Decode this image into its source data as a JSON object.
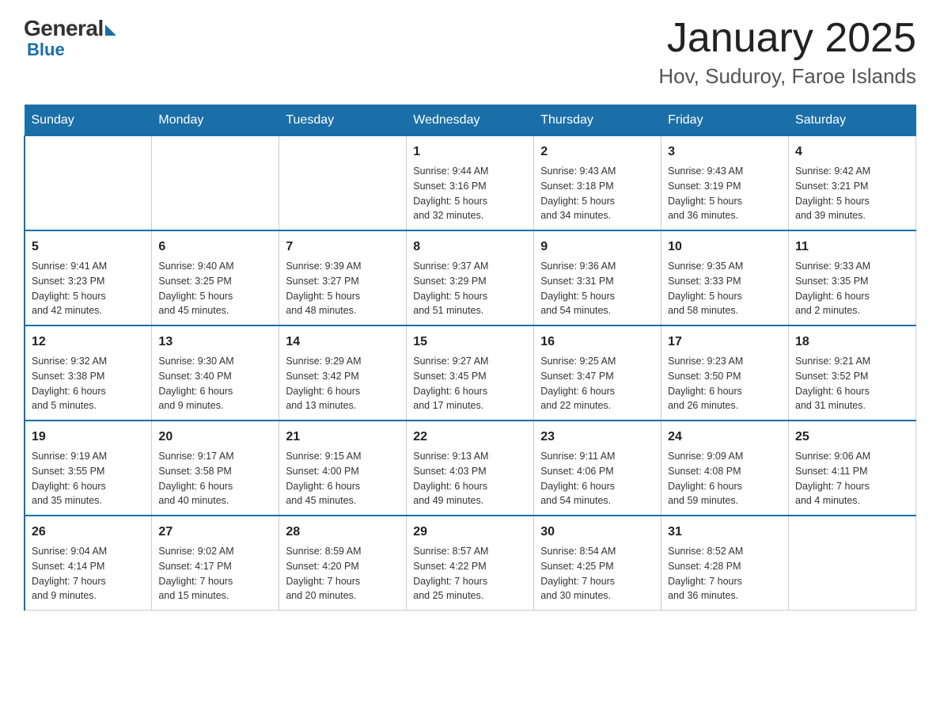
{
  "logo": {
    "general_text": "General",
    "blue_text": "Blue"
  },
  "title": "January 2025",
  "subtitle": "Hov, Suduroy, Faroe Islands",
  "weekdays": [
    "Sunday",
    "Monday",
    "Tuesday",
    "Wednesday",
    "Thursday",
    "Friday",
    "Saturday"
  ],
  "weeks": [
    [
      {
        "day": "",
        "info": ""
      },
      {
        "day": "",
        "info": ""
      },
      {
        "day": "",
        "info": ""
      },
      {
        "day": "1",
        "info": "Sunrise: 9:44 AM\nSunset: 3:16 PM\nDaylight: 5 hours\nand 32 minutes."
      },
      {
        "day": "2",
        "info": "Sunrise: 9:43 AM\nSunset: 3:18 PM\nDaylight: 5 hours\nand 34 minutes."
      },
      {
        "day": "3",
        "info": "Sunrise: 9:43 AM\nSunset: 3:19 PM\nDaylight: 5 hours\nand 36 minutes."
      },
      {
        "day": "4",
        "info": "Sunrise: 9:42 AM\nSunset: 3:21 PM\nDaylight: 5 hours\nand 39 minutes."
      }
    ],
    [
      {
        "day": "5",
        "info": "Sunrise: 9:41 AM\nSunset: 3:23 PM\nDaylight: 5 hours\nand 42 minutes."
      },
      {
        "day": "6",
        "info": "Sunrise: 9:40 AM\nSunset: 3:25 PM\nDaylight: 5 hours\nand 45 minutes."
      },
      {
        "day": "7",
        "info": "Sunrise: 9:39 AM\nSunset: 3:27 PM\nDaylight: 5 hours\nand 48 minutes."
      },
      {
        "day": "8",
        "info": "Sunrise: 9:37 AM\nSunset: 3:29 PM\nDaylight: 5 hours\nand 51 minutes."
      },
      {
        "day": "9",
        "info": "Sunrise: 9:36 AM\nSunset: 3:31 PM\nDaylight: 5 hours\nand 54 minutes."
      },
      {
        "day": "10",
        "info": "Sunrise: 9:35 AM\nSunset: 3:33 PM\nDaylight: 5 hours\nand 58 minutes."
      },
      {
        "day": "11",
        "info": "Sunrise: 9:33 AM\nSunset: 3:35 PM\nDaylight: 6 hours\nand 2 minutes."
      }
    ],
    [
      {
        "day": "12",
        "info": "Sunrise: 9:32 AM\nSunset: 3:38 PM\nDaylight: 6 hours\nand 5 minutes."
      },
      {
        "day": "13",
        "info": "Sunrise: 9:30 AM\nSunset: 3:40 PM\nDaylight: 6 hours\nand 9 minutes."
      },
      {
        "day": "14",
        "info": "Sunrise: 9:29 AM\nSunset: 3:42 PM\nDaylight: 6 hours\nand 13 minutes."
      },
      {
        "day": "15",
        "info": "Sunrise: 9:27 AM\nSunset: 3:45 PM\nDaylight: 6 hours\nand 17 minutes."
      },
      {
        "day": "16",
        "info": "Sunrise: 9:25 AM\nSunset: 3:47 PM\nDaylight: 6 hours\nand 22 minutes."
      },
      {
        "day": "17",
        "info": "Sunrise: 9:23 AM\nSunset: 3:50 PM\nDaylight: 6 hours\nand 26 minutes."
      },
      {
        "day": "18",
        "info": "Sunrise: 9:21 AM\nSunset: 3:52 PM\nDaylight: 6 hours\nand 31 minutes."
      }
    ],
    [
      {
        "day": "19",
        "info": "Sunrise: 9:19 AM\nSunset: 3:55 PM\nDaylight: 6 hours\nand 35 minutes."
      },
      {
        "day": "20",
        "info": "Sunrise: 9:17 AM\nSunset: 3:58 PM\nDaylight: 6 hours\nand 40 minutes."
      },
      {
        "day": "21",
        "info": "Sunrise: 9:15 AM\nSunset: 4:00 PM\nDaylight: 6 hours\nand 45 minutes."
      },
      {
        "day": "22",
        "info": "Sunrise: 9:13 AM\nSunset: 4:03 PM\nDaylight: 6 hours\nand 49 minutes."
      },
      {
        "day": "23",
        "info": "Sunrise: 9:11 AM\nSunset: 4:06 PM\nDaylight: 6 hours\nand 54 minutes."
      },
      {
        "day": "24",
        "info": "Sunrise: 9:09 AM\nSunset: 4:08 PM\nDaylight: 6 hours\nand 59 minutes."
      },
      {
        "day": "25",
        "info": "Sunrise: 9:06 AM\nSunset: 4:11 PM\nDaylight: 7 hours\nand 4 minutes."
      }
    ],
    [
      {
        "day": "26",
        "info": "Sunrise: 9:04 AM\nSunset: 4:14 PM\nDaylight: 7 hours\nand 9 minutes."
      },
      {
        "day": "27",
        "info": "Sunrise: 9:02 AM\nSunset: 4:17 PM\nDaylight: 7 hours\nand 15 minutes."
      },
      {
        "day": "28",
        "info": "Sunrise: 8:59 AM\nSunset: 4:20 PM\nDaylight: 7 hours\nand 20 minutes."
      },
      {
        "day": "29",
        "info": "Sunrise: 8:57 AM\nSunset: 4:22 PM\nDaylight: 7 hours\nand 25 minutes."
      },
      {
        "day": "30",
        "info": "Sunrise: 8:54 AM\nSunset: 4:25 PM\nDaylight: 7 hours\nand 30 minutes."
      },
      {
        "day": "31",
        "info": "Sunrise: 8:52 AM\nSunset: 4:28 PM\nDaylight: 7 hours\nand 36 minutes."
      },
      {
        "day": "",
        "info": ""
      }
    ]
  ]
}
